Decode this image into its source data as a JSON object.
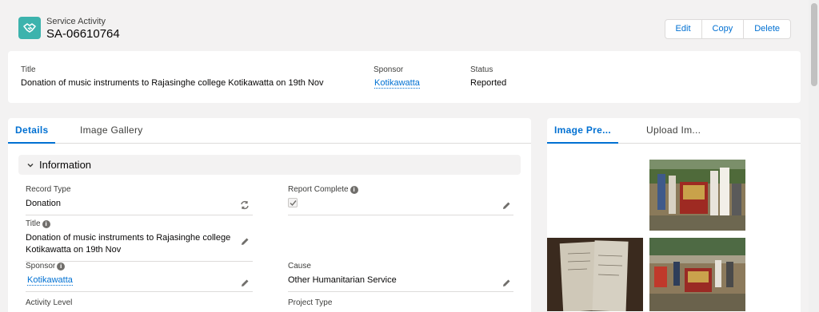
{
  "header": {
    "object_label": "Service Activity",
    "record_name": "SA-06610764",
    "icon": "handshake-icon",
    "actions": [
      "Edit",
      "Copy",
      "Delete"
    ]
  },
  "highlights": {
    "title_label": "Title",
    "title_value": "Donation of music instruments to Rajasinghe college Kotikawatta on 19th Nov",
    "sponsor_label": "Sponsor",
    "sponsor_value": "Kotikawatta",
    "status_label": "Status",
    "status_value": "Reported"
  },
  "left_tabs": [
    "Details",
    "Image Gallery"
  ],
  "right_tabs": [
    "Image Pre...",
    "Upload Im..."
  ],
  "section": {
    "title": "Information"
  },
  "fields": {
    "record_type_label": "Record Type",
    "record_type_value": "Donation",
    "report_complete_label": "Report Complete",
    "report_complete_checked": true,
    "title_label": "Title",
    "title_value": "Donation of music instruments to Rajasinghe college Kotikawatta on 19th Nov",
    "sponsor_label": "Sponsor",
    "sponsor_value": "Kotikawatta",
    "cause_label": "Cause",
    "cause_value": "Other Humanitarian Service",
    "activity_level_label": "Activity Level",
    "project_type_label": "Project Type"
  },
  "colors": {
    "brand": "#0070d2",
    "icon_bg": "#3cb3ad",
    "page_bg": "#f3f2f2"
  }
}
